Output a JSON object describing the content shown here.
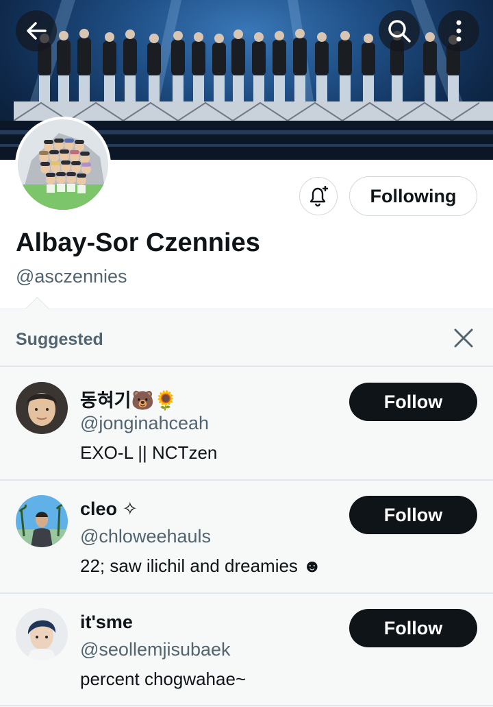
{
  "profile": {
    "name": "Albay-Sor Czennies",
    "handle": "@asczennies",
    "following_label": "Following"
  },
  "icons": {
    "back": "arrow-left-icon",
    "search": "search-icon",
    "more": "more-vertical-icon",
    "notify": "bell-plus-icon",
    "close": "close-icon"
  },
  "suggested": {
    "title": "Suggested",
    "accounts": [
      {
        "name": "동혀기🐻🌻",
        "handle": "@jonginahceah",
        "bio": "EXO-L || NCTzen",
        "follow_label": "Follow"
      },
      {
        "name": "cleo ✧",
        "handle": "@chloweehauls",
        "bio": "22; saw ilichil and dreamies ☻",
        "follow_label": "Follow"
      },
      {
        "name": "it'sme",
        "handle": "@seollemjisubaek",
        "bio": "percent chogwahae~",
        "follow_label": "Follow"
      }
    ]
  },
  "colors": {
    "text_primary": "#0f1419",
    "text_secondary": "#536471",
    "follow_bg": "#0f1419",
    "border": "#cfd9de"
  }
}
